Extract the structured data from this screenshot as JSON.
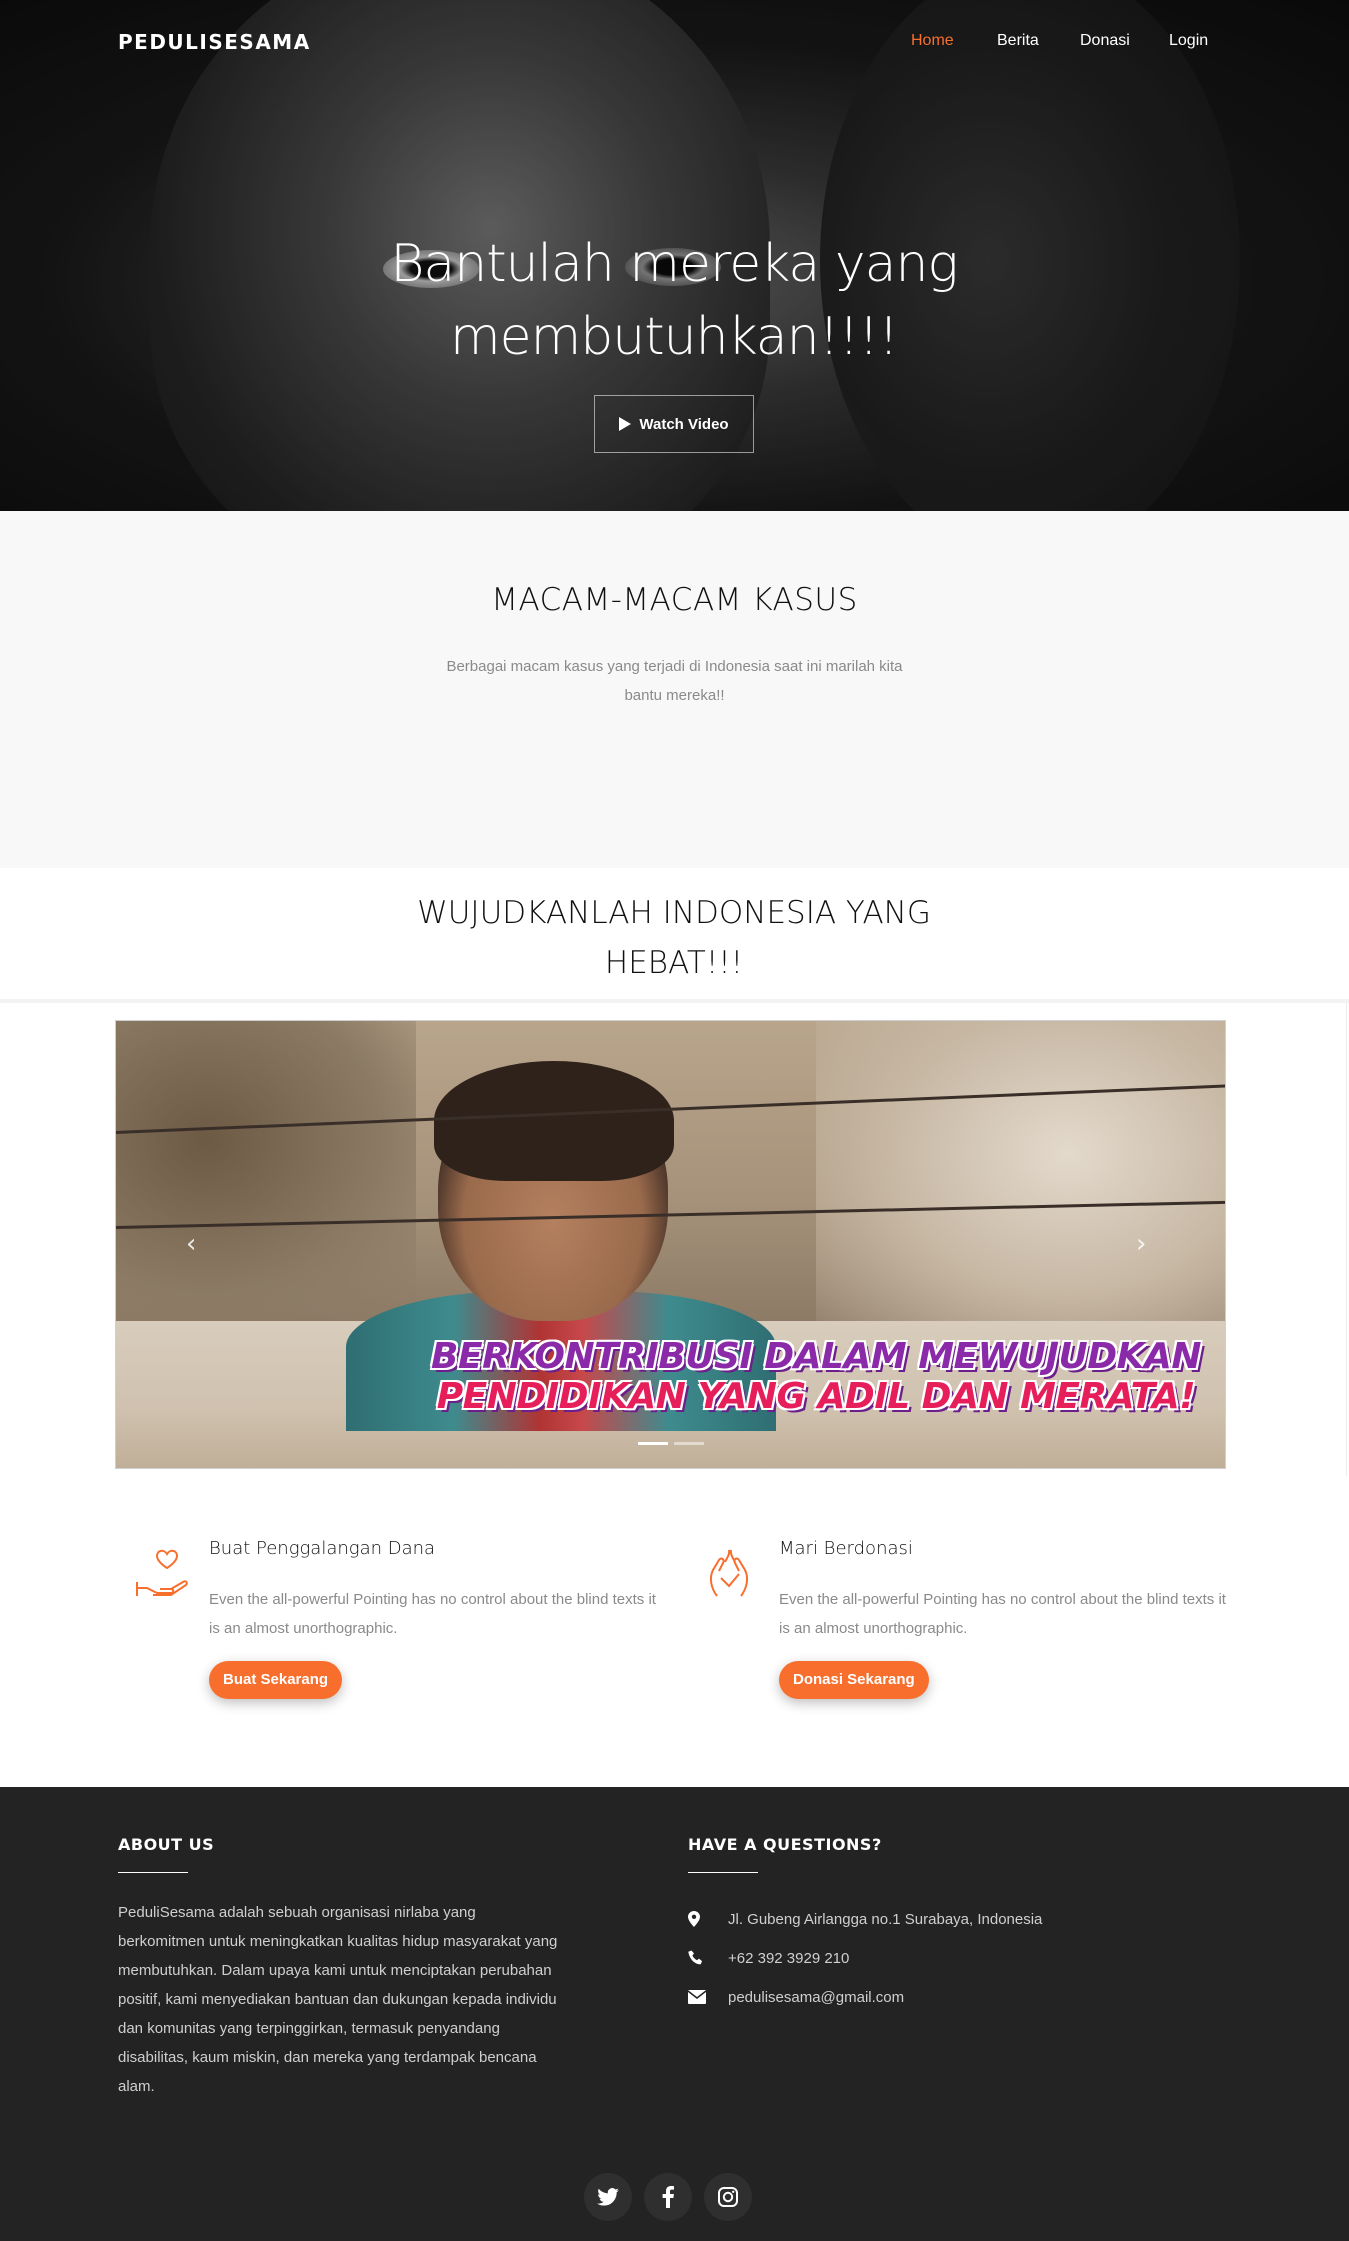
{
  "nav": {
    "brand": "PEDULISESAMA",
    "items": [
      {
        "label": "Home",
        "active": true
      },
      {
        "label": "Berita",
        "active": false
      },
      {
        "label": "Donasi",
        "active": false
      },
      {
        "label": "Login",
        "active": false
      }
    ]
  },
  "hero": {
    "title": "Bantulah mereka yang membutuhkan!!!!",
    "button_label": "Watch Video",
    "button_icon": "play-icon"
  },
  "cases": {
    "title": "MACAM-MACAM KASUS",
    "description": "Berbagai macam kasus yang terjadi di Indonesia saat ini marilah kita bantu mereka!!"
  },
  "campaign": {
    "title": "WUJUDKANLAH INDONESIA YANG HEBAT!!!",
    "slide_text_line1": "BERKONTRIBUSI DALAM MEWUJUDKAN",
    "slide_text_line2": "PENDIDIKAN YANG ADIL DAN MERATA!",
    "prev_arrow": "‹",
    "next_arrow": "›",
    "slide_count": 2,
    "active_slide": 1
  },
  "services": [
    {
      "icon": "heart-hand-icon",
      "title": "Buat Penggalangan Dana",
      "description": "Even the all-powerful Pointing has no control about the blind texts it is an almost unorthographic.",
      "button_label": "Buat Sekarang"
    },
    {
      "icon": "donation-hands-icon",
      "title": "Mari Berdonasi",
      "description": "Even the all-powerful Pointing has no control about the blind texts it is an almost unorthographic.",
      "button_label": "Donasi Sekarang"
    }
  ],
  "footer": {
    "about_title": "ABOUT US",
    "about_text": "PeduliSesama adalah sebuah organisasi nirlaba yang berkomitmen untuk meningkatkan kualitas hidup masyarakat yang membutuhkan. Dalam upaya kami untuk menciptakan perubahan positif, kami menyediakan bantuan dan dukungan kepada individu dan komunitas yang terpinggirkan, termasuk penyandang disabilitas, kaum miskin, dan mereka yang terdampak bencana alam.",
    "questions_title": "HAVE A QUESTIONS?",
    "contacts": [
      {
        "icon": "map-pin-icon",
        "text": "Jl. Gubeng Airlangga no.1 Surabaya, Indonesia"
      },
      {
        "icon": "phone-icon",
        "text": "+62 392 3929 210"
      },
      {
        "icon": "envelope-icon",
        "text": "pedulisesama@gmail.com"
      }
    ],
    "socials": [
      "twitter-icon",
      "facebook-icon",
      "instagram-icon"
    ]
  },
  "colors": {
    "accent": "#f86f2d",
    "footer_bg": "#232323",
    "cases_bg": "#f8f8f8"
  }
}
